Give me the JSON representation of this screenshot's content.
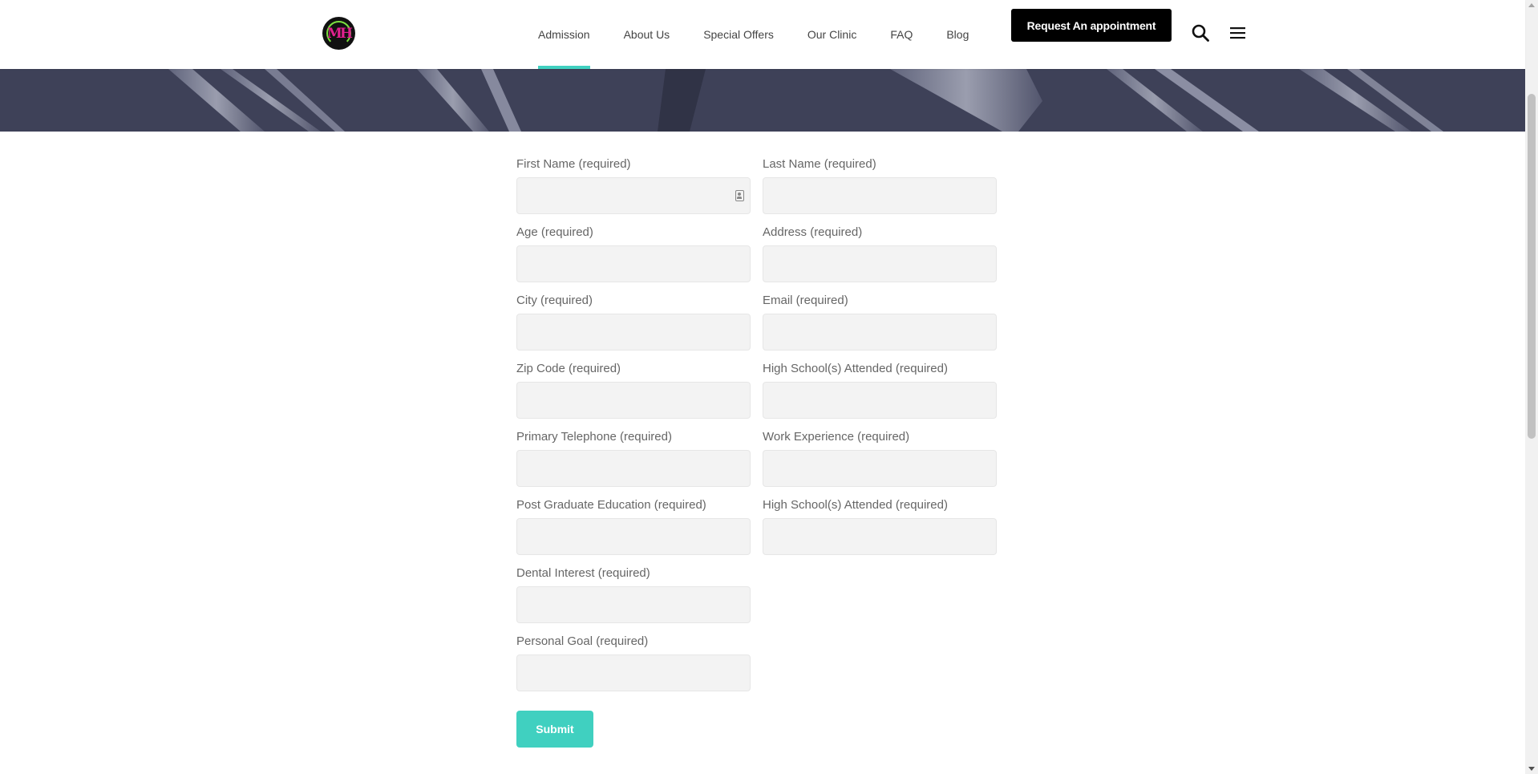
{
  "header": {
    "logo_text": "MH",
    "nav": [
      {
        "label": "Admission",
        "active": true
      },
      {
        "label": "About Us",
        "active": false
      },
      {
        "label": "Special Offers",
        "active": false
      },
      {
        "label": "Our Clinic",
        "active": false
      },
      {
        "label": "FAQ",
        "active": false
      },
      {
        "label": "Blog",
        "active": false
      }
    ],
    "cta_label": "Request An appointment",
    "search_icon": "search-icon",
    "menu_icon": "hamburger-menu-icon"
  },
  "colors": {
    "accent": "#40d0c0",
    "cta_bg": "#000000",
    "hero_bg": "#3e4158",
    "input_bg": "#f3f3f3"
  },
  "form": {
    "rows": [
      [
        {
          "label": "First Name (required)",
          "value": ""
        },
        {
          "label": "Last Name (required)",
          "value": ""
        }
      ],
      [
        {
          "label": "Age (required)",
          "value": ""
        },
        {
          "label": "Address (required)",
          "value": ""
        }
      ],
      [
        {
          "label": "City (required)",
          "value": ""
        },
        {
          "label": "Email (required)",
          "value": ""
        }
      ],
      [
        {
          "label": "Zip Code (required)",
          "value": ""
        },
        {
          "label": "High School(s) Attended (required)",
          "value": ""
        }
      ],
      [
        {
          "label": "Primary Telephone (required)",
          "value": ""
        },
        {
          "label": "Work Experience (required)",
          "value": ""
        }
      ],
      [
        {
          "label": "Post Graduate Education (required)",
          "value": ""
        },
        {
          "label": "High School(s) Attended (required)",
          "value": ""
        }
      ],
      [
        {
          "label": "Dental Interest (required)",
          "value": ""
        }
      ],
      [
        {
          "label": "Personal Goal (required)",
          "value": ""
        }
      ]
    ],
    "submit_label": "Submit"
  }
}
